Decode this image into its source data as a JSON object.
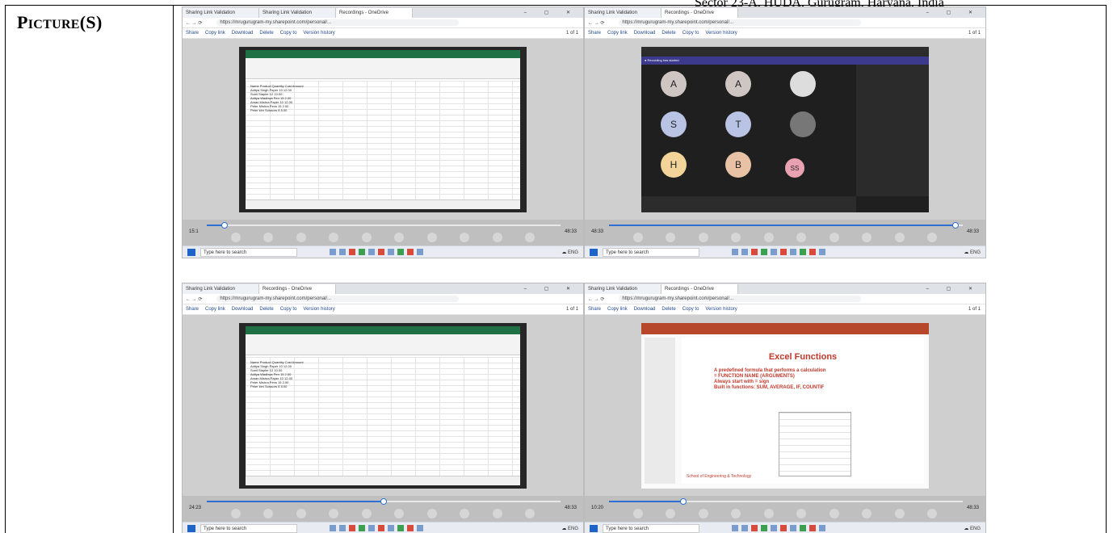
{
  "header_text": "Sector 23-A, HUDA, Gurugram, Haryana, India",
  "label": {
    "big_p": "P",
    "rest": "ICTURE",
    "paren": "(S)"
  },
  "browser": {
    "tab_validation": "Sharing Link Validation",
    "tab_recordings": "Recordings - OneDrive",
    "url": "https://mrugurugram-my.sharepoint.com/personal/...",
    "toolbar": [
      "Share",
      "Copy link",
      "Download",
      "Delete",
      "Copy to",
      "Version history"
    ],
    "page": "1 of 1",
    "search_placeholder": "Type here to search"
  },
  "shots": [
    {
      "time_left": "15:1",
      "time_right": "48:33",
      "progress": 0.05
    },
    {
      "time_left": "48:33",
      "time_right": "48:33",
      "progress": 0.98
    },
    {
      "time_left": "24:23",
      "time_right": "48:33",
      "progress": 0.5
    },
    {
      "time_left": "10:20",
      "time_right": "48:33",
      "progress": 0.21
    }
  ],
  "excel_rows": [
    "Name Product Quantity Cost Amount",
    "Aditya Singh Paper 10 12.00",
    "Sunil Stapler 12 10.00",
    "Aditya Wadhwa Pen 15 2.00",
    "Aman Mishra Paper 10 12.00",
    "Peter Mishra Pens 15 2.00",
    "Peter kim Scissors 8 5.00"
  ],
  "teams": {
    "initials": [
      "A",
      "A",
      "S",
      "T",
      "H",
      "B",
      "SS"
    ]
  },
  "slide": {
    "title": "Excel Functions",
    "bullets": [
      "A predefined formula that performs a calculation",
      "= FUNCTION NAME (ARGUMENTS)",
      "Always start with = sign",
      "Built in functions: SUM, AVERAGE, IF, COUNTIF"
    ],
    "footer": "School of Engineering & Technology"
  }
}
